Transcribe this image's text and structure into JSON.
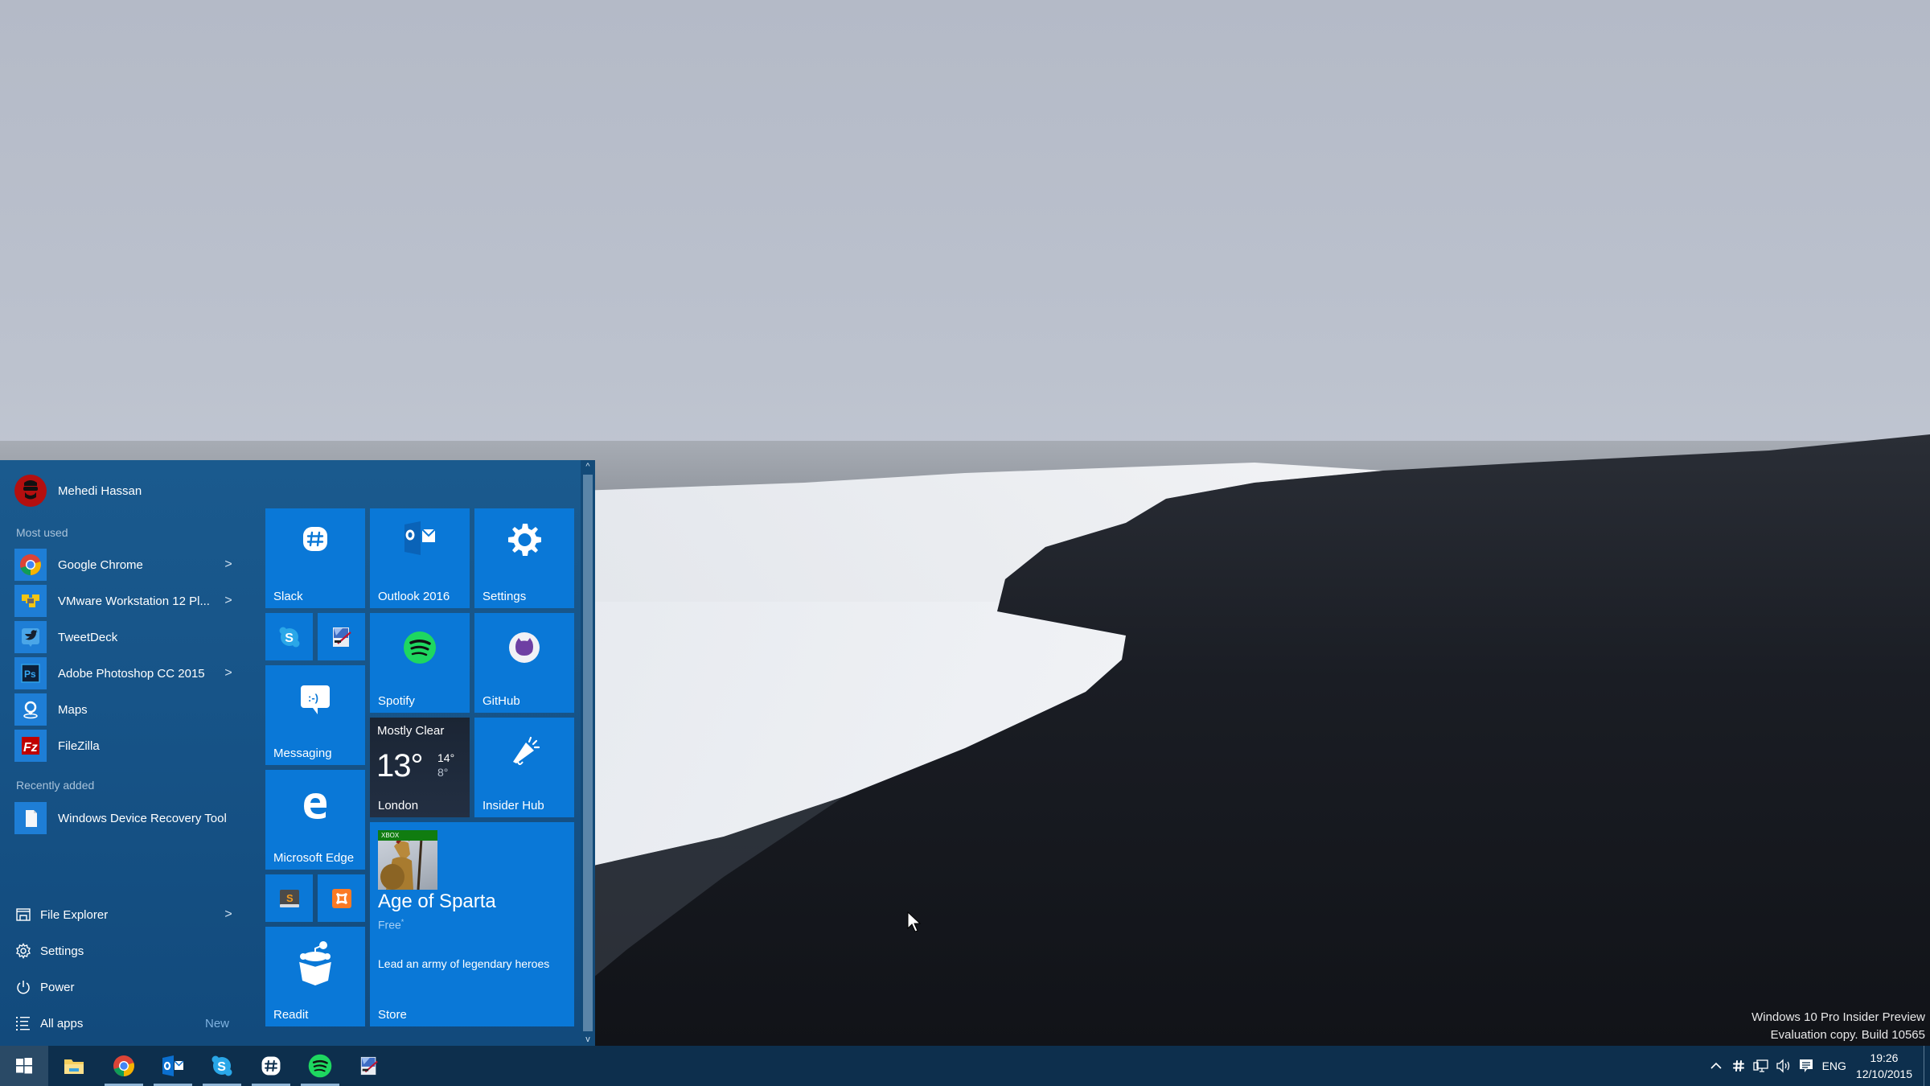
{
  "desktop": {
    "watermark_line1": "Windows 10 Pro Insider Preview",
    "watermark_line2": "Evaluation copy. Build 10565"
  },
  "start_menu": {
    "user": {
      "name": "Mehedi Hassan",
      "avatar_icon": "user-avatar-icon"
    },
    "most_used_label": "Most used",
    "most_used": [
      {
        "label": "Google Chrome",
        "icon": "chrome-icon",
        "has_submenu": true
      },
      {
        "label": "VMware Workstation 12 Pl...",
        "icon": "vmware-icon",
        "has_submenu": true
      },
      {
        "label": "TweetDeck",
        "icon": "tweetdeck-icon",
        "has_submenu": false
      },
      {
        "label": "Adobe Photoshop CC 2015",
        "icon": "photoshop-icon",
        "has_submenu": true
      },
      {
        "label": "Maps",
        "icon": "maps-icon",
        "has_submenu": false
      },
      {
        "label": "FileZilla",
        "icon": "filezilla-icon",
        "has_submenu": false
      }
    ],
    "recently_added_label": "Recently added",
    "recently_added": [
      {
        "label": "Windows Device Recovery Tool",
        "icon": "document-icon"
      }
    ],
    "bottom": [
      {
        "label": "File Explorer",
        "icon": "file-explorer-icon",
        "has_submenu": true
      },
      {
        "label": "Settings",
        "icon": "gear-icon",
        "has_submenu": false
      },
      {
        "label": "Power",
        "icon": "power-icon",
        "has_submenu": false
      },
      {
        "label": "All apps",
        "icon": "list-icon",
        "badge": "New"
      }
    ],
    "chevron": ">",
    "tiles": {
      "slack": "Slack",
      "outlook": "Outlook 2016",
      "settings": "Settings",
      "spotify": "Spotify",
      "github": "GitHub",
      "messaging": "Messaging",
      "edge": "Microsoft Edge",
      "insider_hub": "Insider Hub",
      "readit": "Readit",
      "weather": {
        "condition": "Mostly Clear",
        "temp": "13°",
        "high": "14°",
        "low": "8°",
        "city": "London"
      },
      "store": {
        "badge": "XBOX",
        "title": "Age of Sparta",
        "price": "Free",
        "price_mark": "*",
        "description": "Lead an army of legendary heroes",
        "label": "Store"
      }
    },
    "scroll_up": "^",
    "scroll_down": "v"
  },
  "taskbar": {
    "pinned": [
      {
        "name": "file-explorer",
        "running": false
      },
      {
        "name": "chrome",
        "running": true
      },
      {
        "name": "outlook",
        "running": true
      },
      {
        "name": "skype",
        "running": true
      },
      {
        "name": "slack",
        "running": true
      },
      {
        "name": "spotify",
        "running": true
      },
      {
        "name": "snipping-tool",
        "running": false
      }
    ],
    "tray": {
      "language": "ENG",
      "time": "19:26",
      "date": "12/10/2015"
    }
  },
  "colors": {
    "accent": "#0a78d7",
    "start_bg": "#175488",
    "taskbar_bg": "#0d2f4d"
  }
}
